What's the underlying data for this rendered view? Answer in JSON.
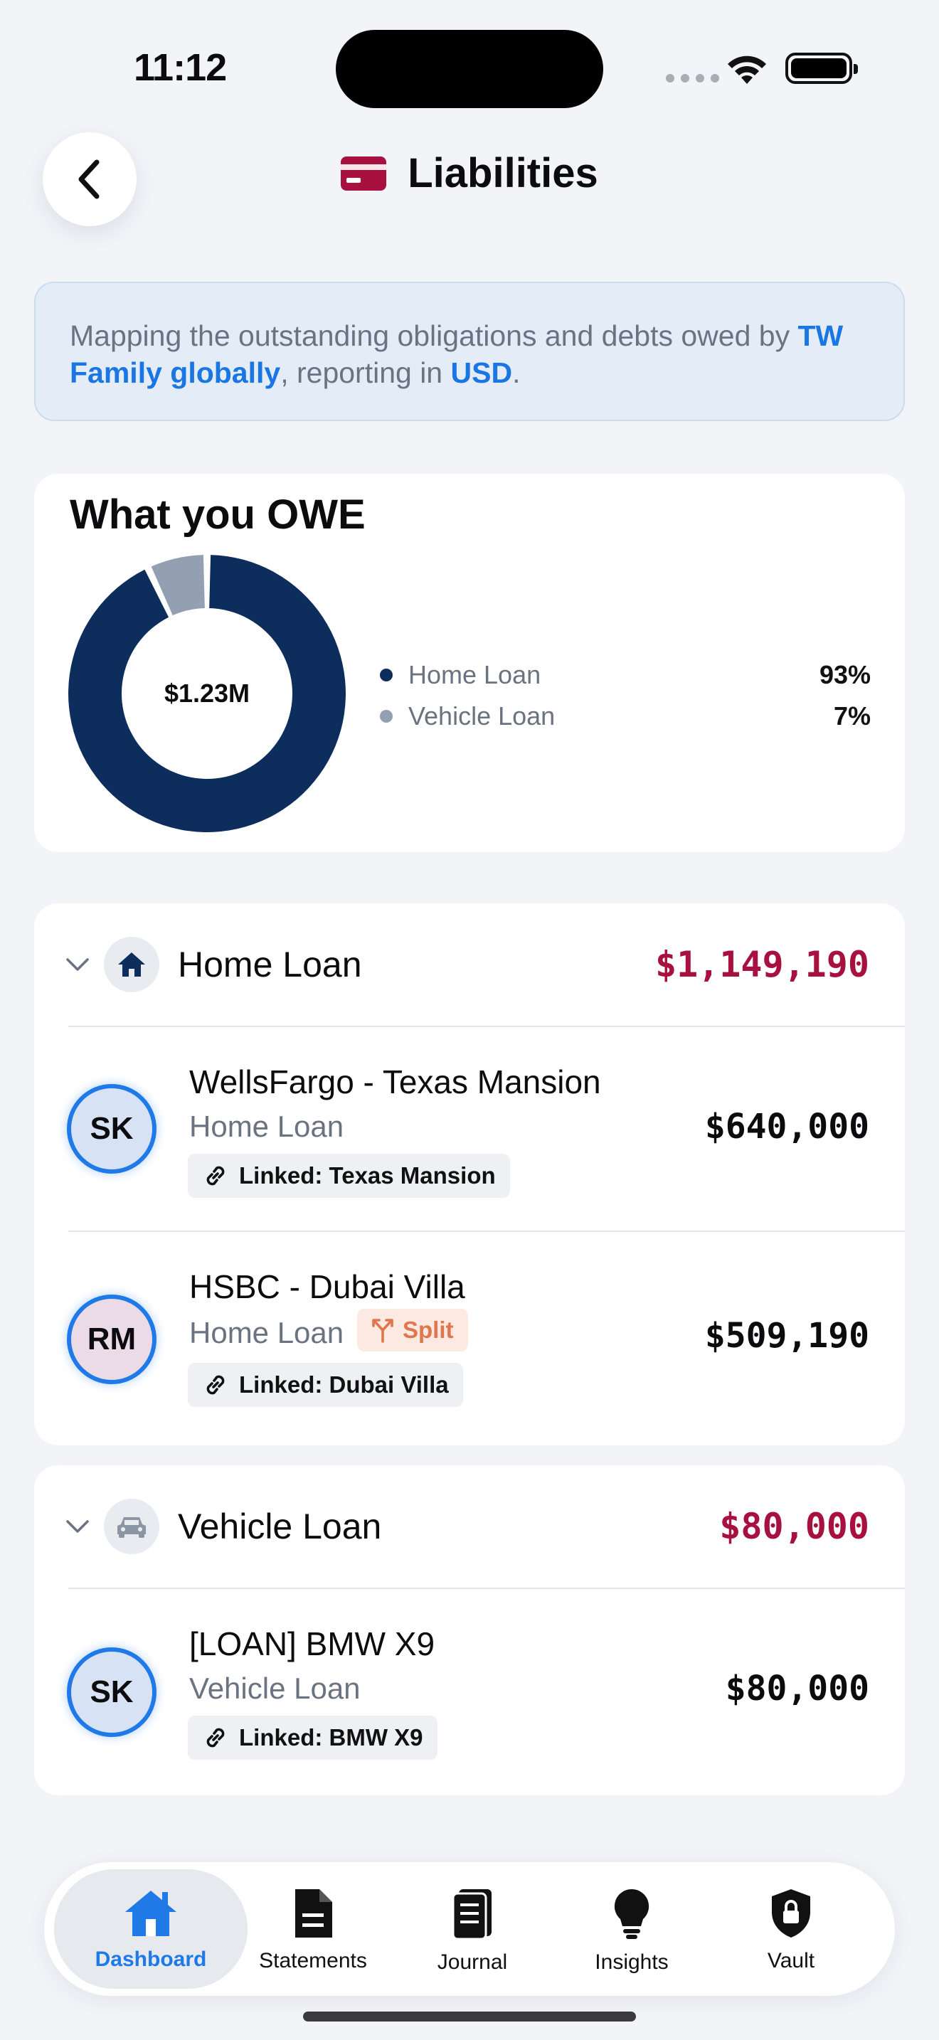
{
  "status": {
    "time": "11:12"
  },
  "header": {
    "title": "Liabilities"
  },
  "banner": {
    "text_before": "Mapping the outstanding obligations and debts owed by ",
    "entity": "TW Family globally",
    "text_middle": ", reporting in ",
    "currency": "USD",
    "text_after": "."
  },
  "owe": {
    "title": "What you OWE",
    "total": "$1.23M"
  },
  "chart_data": {
    "type": "pie",
    "categories": [
      "Home Loan",
      "Vehicle Loan"
    ],
    "values": [
      93,
      7
    ],
    "colors": [
      "#0d2e5c",
      "#949fb1"
    ],
    "center_label": "$1.23M",
    "labels": [
      "93%",
      "7%"
    ]
  },
  "groups": [
    {
      "name": "Home Loan",
      "total": "$1,149,190",
      "icon": "house-icon",
      "accounts": [
        {
          "initials": "SK",
          "name": "WellsFargo - Texas Mansion",
          "type": "Home Loan",
          "linked": "Linked: Texas Mansion",
          "amount": "$640,000"
        },
        {
          "initials": "RM",
          "name": "HSBC - Dubai Villa",
          "type": "Home Loan",
          "split": "Split",
          "linked": "Linked: Dubai Villa",
          "amount": "$509,190"
        }
      ]
    },
    {
      "name": "Vehicle Loan",
      "total": "$80,000",
      "icon": "car-icon",
      "accounts": [
        {
          "initials": "SK",
          "name": "[LOAN] BMW X9",
          "type": "Vehicle Loan",
          "linked": "Linked: BMW X9",
          "amount": "$80,000"
        }
      ]
    }
  ],
  "tabs": [
    {
      "label": "Dashboard",
      "icon": "house-icon",
      "active": true
    },
    {
      "label": "Statements",
      "icon": "document-icon"
    },
    {
      "label": "Journal",
      "icon": "journal-icon"
    },
    {
      "label": "Insights",
      "icon": "lightbulb-icon"
    },
    {
      "label": "Vault",
      "icon": "shield-lock-icon"
    }
  ],
  "colors": {
    "accent": "#1f7ae8",
    "liability": "#a8103f",
    "navy": "#0d2e5c"
  }
}
